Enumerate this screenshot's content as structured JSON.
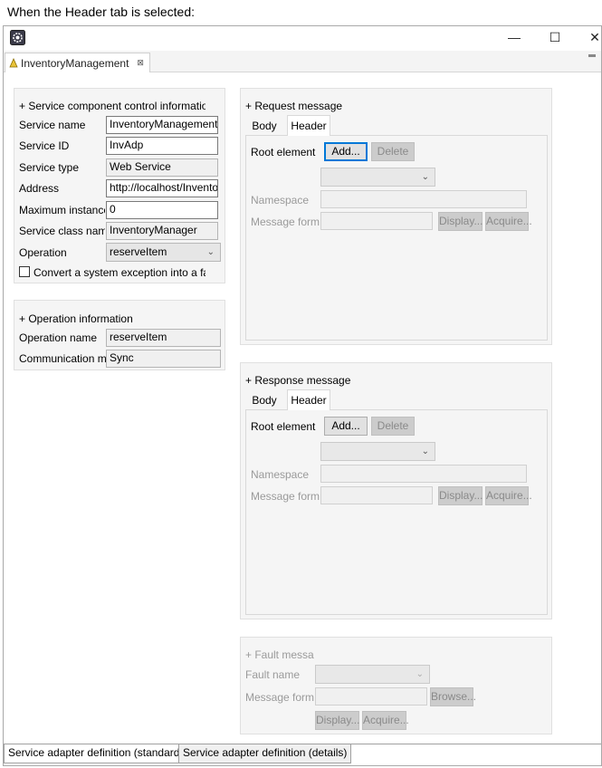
{
  "caption": "When the Header tab is selected:",
  "window": {
    "icon": "gear-app-icon",
    "minimize": "—",
    "maximize": "☐",
    "close": "✕"
  },
  "editor_tab": {
    "label": "InventoryManagement",
    "close": "⊠"
  },
  "service_component": {
    "heading": "+ Service component control informatio",
    "fields": [
      {
        "label": "Service name",
        "value": "InventoryManagement"
      },
      {
        "label": "Service ID",
        "value": "InvAdp"
      },
      {
        "label": "Service type",
        "value": "Web Service"
      },
      {
        "label": "Address",
        "value": "http://localhost/Invento"
      },
      {
        "label": "Maximum instance",
        "value": "0"
      },
      {
        "label": "Service class name",
        "value": "InventoryManager"
      },
      {
        "label": "Operation",
        "value": "reserveItem"
      }
    ],
    "checkbox_label": "Convert a system exception into a fau"
  },
  "operation_info": {
    "heading": "+ Operation information",
    "fields": [
      {
        "label": "Operation name",
        "value": "reserveItem"
      },
      {
        "label": "Communication m",
        "value": "Sync"
      }
    ]
  },
  "request": {
    "heading": "+ Request message",
    "tabs": [
      "Body",
      "Header"
    ],
    "root_label": "Root element",
    "add": "Add...",
    "delete": "Delete",
    "namespace": "Namespace",
    "message_form": "Message form",
    "display": "Display...",
    "acquire": "Acquire..."
  },
  "response": {
    "heading": "+ Response message",
    "tabs": [
      "Body",
      "Header"
    ],
    "root_label": "Root element",
    "add": "Add...",
    "delete": "Delete",
    "namespace": "Namespace",
    "message_form": "Message form",
    "display": "Display...",
    "acquire": "Acquire..."
  },
  "fault": {
    "heading": "+ Fault messag",
    "fault_name": "Fault name",
    "message_form": "Message form",
    "browse": "Browse...",
    "display": "Display...",
    "acquire": "Acquire..."
  },
  "bottom_tabs": [
    "Service adapter definition (standard)",
    "Service adapter definition (details)"
  ]
}
